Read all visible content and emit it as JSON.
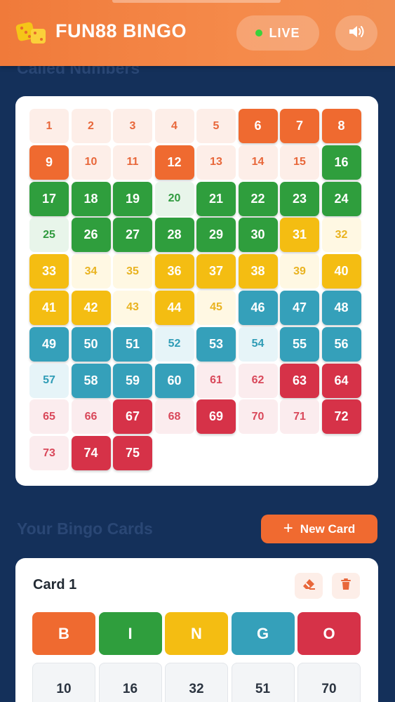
{
  "header": {
    "brand": "FUN88 BINGO",
    "live_label": "LIVE",
    "logo_icon": "dice-icon",
    "sound_icon": "speaker-icon",
    "live_dot_color": "#3bd13b"
  },
  "called_section": {
    "title": "Called Numbers",
    "numbers": [
      {
        "n": "1",
        "c": false,
        "g": "b"
      },
      {
        "n": "2",
        "c": false,
        "g": "b"
      },
      {
        "n": "3",
        "c": false,
        "g": "b"
      },
      {
        "n": "4",
        "c": false,
        "g": "b"
      },
      {
        "n": "5",
        "c": false,
        "g": "b"
      },
      {
        "n": "6",
        "c": true,
        "g": "b"
      },
      {
        "n": "7",
        "c": true,
        "g": "b"
      },
      {
        "n": "8",
        "c": true,
        "g": "b"
      },
      {
        "n": "9",
        "c": true,
        "g": "b"
      },
      {
        "n": "10",
        "c": false,
        "g": "b"
      },
      {
        "n": "11",
        "c": false,
        "g": "b"
      },
      {
        "n": "12",
        "c": true,
        "g": "b"
      },
      {
        "n": "13",
        "c": false,
        "g": "b"
      },
      {
        "n": "14",
        "c": false,
        "g": "b"
      },
      {
        "n": "15",
        "c": false,
        "g": "b"
      },
      {
        "n": "16",
        "c": true,
        "g": "i"
      },
      {
        "n": "17",
        "c": true,
        "g": "i"
      },
      {
        "n": "18",
        "c": true,
        "g": "i"
      },
      {
        "n": "19",
        "c": true,
        "g": "i"
      },
      {
        "n": "20",
        "c": false,
        "g": "i"
      },
      {
        "n": "21",
        "c": true,
        "g": "i"
      },
      {
        "n": "22",
        "c": true,
        "g": "i"
      },
      {
        "n": "23",
        "c": true,
        "g": "i"
      },
      {
        "n": "24",
        "c": true,
        "g": "i"
      },
      {
        "n": "25",
        "c": false,
        "g": "i"
      },
      {
        "n": "26",
        "c": true,
        "g": "i"
      },
      {
        "n": "27",
        "c": true,
        "g": "i"
      },
      {
        "n": "28",
        "c": true,
        "g": "i"
      },
      {
        "n": "29",
        "c": true,
        "g": "i"
      },
      {
        "n": "30",
        "c": true,
        "g": "i"
      },
      {
        "n": "31",
        "c": true,
        "g": "n"
      },
      {
        "n": "32",
        "c": false,
        "g": "n"
      },
      {
        "n": "33",
        "c": true,
        "g": "n"
      },
      {
        "n": "34",
        "c": false,
        "g": "n"
      },
      {
        "n": "35",
        "c": false,
        "g": "n"
      },
      {
        "n": "36",
        "c": true,
        "g": "n"
      },
      {
        "n": "37",
        "c": true,
        "g": "n"
      },
      {
        "n": "38",
        "c": true,
        "g": "n"
      },
      {
        "n": "39",
        "c": false,
        "g": "n"
      },
      {
        "n": "40",
        "c": true,
        "g": "n"
      },
      {
        "n": "41",
        "c": true,
        "g": "n"
      },
      {
        "n": "42",
        "c": true,
        "g": "n"
      },
      {
        "n": "43",
        "c": false,
        "g": "n"
      },
      {
        "n": "44",
        "c": true,
        "g": "n"
      },
      {
        "n": "45",
        "c": false,
        "g": "n"
      },
      {
        "n": "46",
        "c": true,
        "g": "g"
      },
      {
        "n": "47",
        "c": true,
        "g": "g"
      },
      {
        "n": "48",
        "c": true,
        "g": "g"
      },
      {
        "n": "49",
        "c": true,
        "g": "g"
      },
      {
        "n": "50",
        "c": true,
        "g": "g"
      },
      {
        "n": "51",
        "c": true,
        "g": "g"
      },
      {
        "n": "52",
        "c": false,
        "g": "g"
      },
      {
        "n": "53",
        "c": true,
        "g": "g"
      },
      {
        "n": "54",
        "c": false,
        "g": "g"
      },
      {
        "n": "55",
        "c": true,
        "g": "g"
      },
      {
        "n": "56",
        "c": true,
        "g": "g"
      },
      {
        "n": "57",
        "c": false,
        "g": "g"
      },
      {
        "n": "58",
        "c": true,
        "g": "g"
      },
      {
        "n": "59",
        "c": true,
        "g": "g"
      },
      {
        "n": "60",
        "c": true,
        "g": "g"
      },
      {
        "n": "61",
        "c": false,
        "g": "o"
      },
      {
        "n": "62",
        "c": false,
        "g": "o"
      },
      {
        "n": "63",
        "c": true,
        "g": "o"
      },
      {
        "n": "64",
        "c": true,
        "g": "o"
      },
      {
        "n": "65",
        "c": false,
        "g": "o"
      },
      {
        "n": "66",
        "c": false,
        "g": "o"
      },
      {
        "n": "67",
        "c": true,
        "g": "o"
      },
      {
        "n": "68",
        "c": false,
        "g": "o"
      },
      {
        "n": "69",
        "c": true,
        "g": "o"
      },
      {
        "n": "70",
        "c": false,
        "g": "o"
      },
      {
        "n": "71",
        "c": false,
        "g": "o"
      },
      {
        "n": "72",
        "c": true,
        "g": "o"
      },
      {
        "n": "73",
        "c": false,
        "g": "o"
      },
      {
        "n": "74",
        "c": true,
        "g": "o"
      },
      {
        "n": "75",
        "c": true,
        "g": "o"
      }
    ]
  },
  "cards_section": {
    "title": "Your Bingo Cards",
    "new_card_label": "New Card",
    "cards": [
      {
        "title": "Card 1",
        "eraser_icon": "eraser-icon",
        "delete_icon": "trash-icon",
        "letters": [
          {
            "l": "B",
            "color": "#ef6a30"
          },
          {
            "l": "I",
            "color": "#2f9e3d"
          },
          {
            "l": "N",
            "color": "#f4bd12"
          },
          {
            "l": "G",
            "color": "#35a0ba"
          },
          {
            "l": "O",
            "color": "#d63248"
          }
        ],
        "first_row": [
          "10",
          "16",
          "32",
          "51",
          "70"
        ]
      }
    ]
  },
  "colors": {
    "accent_orange": "#f06a30",
    "page_background": "#14305a"
  }
}
